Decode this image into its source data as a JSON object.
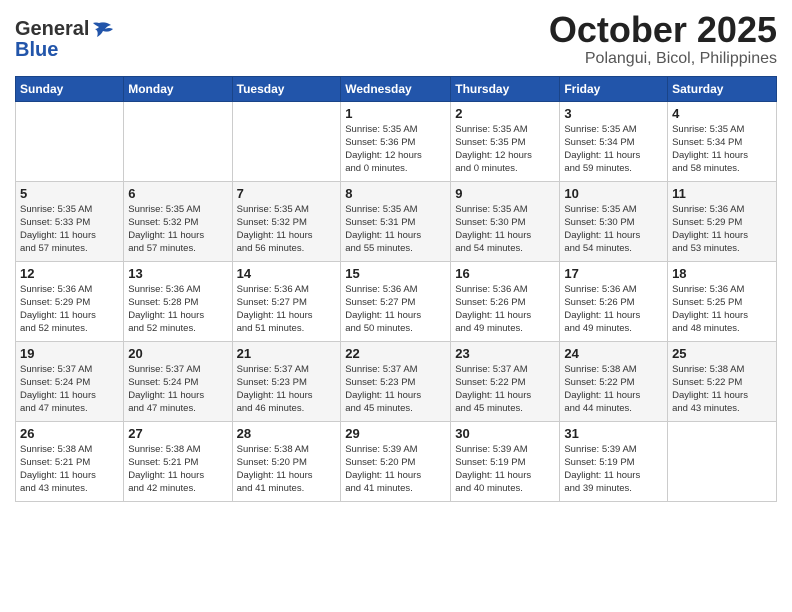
{
  "logo": {
    "general": "General",
    "blue": "Blue"
  },
  "title": "October 2025",
  "subtitle": "Polangui, Bicol, Philippines",
  "weekdays": [
    "Sunday",
    "Monday",
    "Tuesday",
    "Wednesday",
    "Thursday",
    "Friday",
    "Saturday"
  ],
  "weeks": [
    [
      {
        "day": "",
        "info": ""
      },
      {
        "day": "",
        "info": ""
      },
      {
        "day": "",
        "info": ""
      },
      {
        "day": "1",
        "info": "Sunrise: 5:35 AM\nSunset: 5:36 PM\nDaylight: 12 hours\nand 0 minutes."
      },
      {
        "day": "2",
        "info": "Sunrise: 5:35 AM\nSunset: 5:35 PM\nDaylight: 12 hours\nand 0 minutes."
      },
      {
        "day": "3",
        "info": "Sunrise: 5:35 AM\nSunset: 5:34 PM\nDaylight: 11 hours\nand 59 minutes."
      },
      {
        "day": "4",
        "info": "Sunrise: 5:35 AM\nSunset: 5:34 PM\nDaylight: 11 hours\nand 58 minutes."
      }
    ],
    [
      {
        "day": "5",
        "info": "Sunrise: 5:35 AM\nSunset: 5:33 PM\nDaylight: 11 hours\nand 57 minutes."
      },
      {
        "day": "6",
        "info": "Sunrise: 5:35 AM\nSunset: 5:32 PM\nDaylight: 11 hours\nand 57 minutes."
      },
      {
        "day": "7",
        "info": "Sunrise: 5:35 AM\nSunset: 5:32 PM\nDaylight: 11 hours\nand 56 minutes."
      },
      {
        "day": "8",
        "info": "Sunrise: 5:35 AM\nSunset: 5:31 PM\nDaylight: 11 hours\nand 55 minutes."
      },
      {
        "day": "9",
        "info": "Sunrise: 5:35 AM\nSunset: 5:30 PM\nDaylight: 11 hours\nand 54 minutes."
      },
      {
        "day": "10",
        "info": "Sunrise: 5:35 AM\nSunset: 5:30 PM\nDaylight: 11 hours\nand 54 minutes."
      },
      {
        "day": "11",
        "info": "Sunrise: 5:36 AM\nSunset: 5:29 PM\nDaylight: 11 hours\nand 53 minutes."
      }
    ],
    [
      {
        "day": "12",
        "info": "Sunrise: 5:36 AM\nSunset: 5:29 PM\nDaylight: 11 hours\nand 52 minutes."
      },
      {
        "day": "13",
        "info": "Sunrise: 5:36 AM\nSunset: 5:28 PM\nDaylight: 11 hours\nand 52 minutes."
      },
      {
        "day": "14",
        "info": "Sunrise: 5:36 AM\nSunset: 5:27 PM\nDaylight: 11 hours\nand 51 minutes."
      },
      {
        "day": "15",
        "info": "Sunrise: 5:36 AM\nSunset: 5:27 PM\nDaylight: 11 hours\nand 50 minutes."
      },
      {
        "day": "16",
        "info": "Sunrise: 5:36 AM\nSunset: 5:26 PM\nDaylight: 11 hours\nand 49 minutes."
      },
      {
        "day": "17",
        "info": "Sunrise: 5:36 AM\nSunset: 5:26 PM\nDaylight: 11 hours\nand 49 minutes."
      },
      {
        "day": "18",
        "info": "Sunrise: 5:36 AM\nSunset: 5:25 PM\nDaylight: 11 hours\nand 48 minutes."
      }
    ],
    [
      {
        "day": "19",
        "info": "Sunrise: 5:37 AM\nSunset: 5:24 PM\nDaylight: 11 hours\nand 47 minutes."
      },
      {
        "day": "20",
        "info": "Sunrise: 5:37 AM\nSunset: 5:24 PM\nDaylight: 11 hours\nand 47 minutes."
      },
      {
        "day": "21",
        "info": "Sunrise: 5:37 AM\nSunset: 5:23 PM\nDaylight: 11 hours\nand 46 minutes."
      },
      {
        "day": "22",
        "info": "Sunrise: 5:37 AM\nSunset: 5:23 PM\nDaylight: 11 hours\nand 45 minutes."
      },
      {
        "day": "23",
        "info": "Sunrise: 5:37 AM\nSunset: 5:22 PM\nDaylight: 11 hours\nand 45 minutes."
      },
      {
        "day": "24",
        "info": "Sunrise: 5:38 AM\nSunset: 5:22 PM\nDaylight: 11 hours\nand 44 minutes."
      },
      {
        "day": "25",
        "info": "Sunrise: 5:38 AM\nSunset: 5:22 PM\nDaylight: 11 hours\nand 43 minutes."
      }
    ],
    [
      {
        "day": "26",
        "info": "Sunrise: 5:38 AM\nSunset: 5:21 PM\nDaylight: 11 hours\nand 43 minutes."
      },
      {
        "day": "27",
        "info": "Sunrise: 5:38 AM\nSunset: 5:21 PM\nDaylight: 11 hours\nand 42 minutes."
      },
      {
        "day": "28",
        "info": "Sunrise: 5:38 AM\nSunset: 5:20 PM\nDaylight: 11 hours\nand 41 minutes."
      },
      {
        "day": "29",
        "info": "Sunrise: 5:39 AM\nSunset: 5:20 PM\nDaylight: 11 hours\nand 41 minutes."
      },
      {
        "day": "30",
        "info": "Sunrise: 5:39 AM\nSunset: 5:19 PM\nDaylight: 11 hours\nand 40 minutes."
      },
      {
        "day": "31",
        "info": "Sunrise: 5:39 AM\nSunset: 5:19 PM\nDaylight: 11 hours\nand 39 minutes."
      },
      {
        "day": "",
        "info": ""
      }
    ]
  ]
}
